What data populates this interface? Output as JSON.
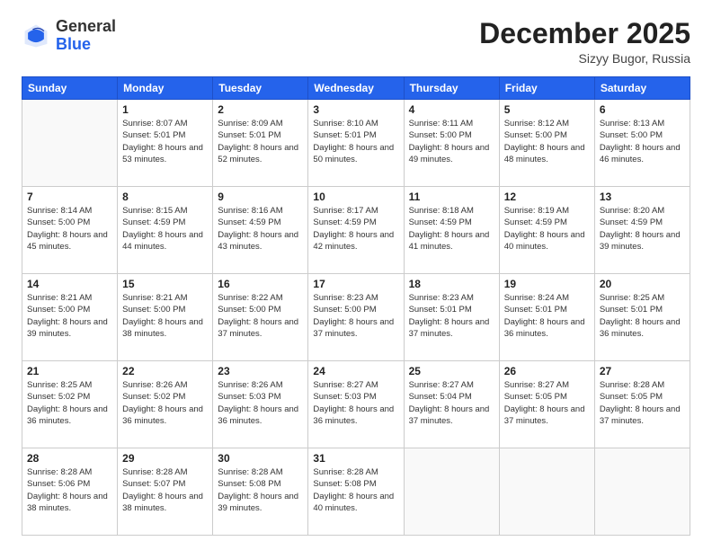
{
  "logo": {
    "general": "General",
    "blue": "Blue"
  },
  "title": "December 2025",
  "location": "Sizyy Bugor, Russia",
  "days_header": [
    "Sunday",
    "Monday",
    "Tuesday",
    "Wednesday",
    "Thursday",
    "Friday",
    "Saturday"
  ],
  "weeks": [
    [
      {
        "day": "",
        "sunrise": "",
        "sunset": "",
        "daylight": ""
      },
      {
        "day": "1",
        "sunrise": "Sunrise: 8:07 AM",
        "sunset": "Sunset: 5:01 PM",
        "daylight": "Daylight: 8 hours and 53 minutes."
      },
      {
        "day": "2",
        "sunrise": "Sunrise: 8:09 AM",
        "sunset": "Sunset: 5:01 PM",
        "daylight": "Daylight: 8 hours and 52 minutes."
      },
      {
        "day": "3",
        "sunrise": "Sunrise: 8:10 AM",
        "sunset": "Sunset: 5:01 PM",
        "daylight": "Daylight: 8 hours and 50 minutes."
      },
      {
        "day": "4",
        "sunrise": "Sunrise: 8:11 AM",
        "sunset": "Sunset: 5:00 PM",
        "daylight": "Daylight: 8 hours and 49 minutes."
      },
      {
        "day": "5",
        "sunrise": "Sunrise: 8:12 AM",
        "sunset": "Sunset: 5:00 PM",
        "daylight": "Daylight: 8 hours and 48 minutes."
      },
      {
        "day": "6",
        "sunrise": "Sunrise: 8:13 AM",
        "sunset": "Sunset: 5:00 PM",
        "daylight": "Daylight: 8 hours and 46 minutes."
      }
    ],
    [
      {
        "day": "7",
        "sunrise": "Sunrise: 8:14 AM",
        "sunset": "Sunset: 5:00 PM",
        "daylight": "Daylight: 8 hours and 45 minutes."
      },
      {
        "day": "8",
        "sunrise": "Sunrise: 8:15 AM",
        "sunset": "Sunset: 4:59 PM",
        "daylight": "Daylight: 8 hours and 44 minutes."
      },
      {
        "day": "9",
        "sunrise": "Sunrise: 8:16 AM",
        "sunset": "Sunset: 4:59 PM",
        "daylight": "Daylight: 8 hours and 43 minutes."
      },
      {
        "day": "10",
        "sunrise": "Sunrise: 8:17 AM",
        "sunset": "Sunset: 4:59 PM",
        "daylight": "Daylight: 8 hours and 42 minutes."
      },
      {
        "day": "11",
        "sunrise": "Sunrise: 8:18 AM",
        "sunset": "Sunset: 4:59 PM",
        "daylight": "Daylight: 8 hours and 41 minutes."
      },
      {
        "day": "12",
        "sunrise": "Sunrise: 8:19 AM",
        "sunset": "Sunset: 4:59 PM",
        "daylight": "Daylight: 8 hours and 40 minutes."
      },
      {
        "day": "13",
        "sunrise": "Sunrise: 8:20 AM",
        "sunset": "Sunset: 4:59 PM",
        "daylight": "Daylight: 8 hours and 39 minutes."
      }
    ],
    [
      {
        "day": "14",
        "sunrise": "Sunrise: 8:21 AM",
        "sunset": "Sunset: 5:00 PM",
        "daylight": "Daylight: 8 hours and 39 minutes."
      },
      {
        "day": "15",
        "sunrise": "Sunrise: 8:21 AM",
        "sunset": "Sunset: 5:00 PM",
        "daylight": "Daylight: 8 hours and 38 minutes."
      },
      {
        "day": "16",
        "sunrise": "Sunrise: 8:22 AM",
        "sunset": "Sunset: 5:00 PM",
        "daylight": "Daylight: 8 hours and 37 minutes."
      },
      {
        "day": "17",
        "sunrise": "Sunrise: 8:23 AM",
        "sunset": "Sunset: 5:00 PM",
        "daylight": "Daylight: 8 hours and 37 minutes."
      },
      {
        "day": "18",
        "sunrise": "Sunrise: 8:23 AM",
        "sunset": "Sunset: 5:01 PM",
        "daylight": "Daylight: 8 hours and 37 minutes."
      },
      {
        "day": "19",
        "sunrise": "Sunrise: 8:24 AM",
        "sunset": "Sunset: 5:01 PM",
        "daylight": "Daylight: 8 hours and 36 minutes."
      },
      {
        "day": "20",
        "sunrise": "Sunrise: 8:25 AM",
        "sunset": "Sunset: 5:01 PM",
        "daylight": "Daylight: 8 hours and 36 minutes."
      }
    ],
    [
      {
        "day": "21",
        "sunrise": "Sunrise: 8:25 AM",
        "sunset": "Sunset: 5:02 PM",
        "daylight": "Daylight: 8 hours and 36 minutes."
      },
      {
        "day": "22",
        "sunrise": "Sunrise: 8:26 AM",
        "sunset": "Sunset: 5:02 PM",
        "daylight": "Daylight: 8 hours and 36 minutes."
      },
      {
        "day": "23",
        "sunrise": "Sunrise: 8:26 AM",
        "sunset": "Sunset: 5:03 PM",
        "daylight": "Daylight: 8 hours and 36 minutes."
      },
      {
        "day": "24",
        "sunrise": "Sunrise: 8:27 AM",
        "sunset": "Sunset: 5:03 PM",
        "daylight": "Daylight: 8 hours and 36 minutes."
      },
      {
        "day": "25",
        "sunrise": "Sunrise: 8:27 AM",
        "sunset": "Sunset: 5:04 PM",
        "daylight": "Daylight: 8 hours and 37 minutes."
      },
      {
        "day": "26",
        "sunrise": "Sunrise: 8:27 AM",
        "sunset": "Sunset: 5:05 PM",
        "daylight": "Daylight: 8 hours and 37 minutes."
      },
      {
        "day": "27",
        "sunrise": "Sunrise: 8:28 AM",
        "sunset": "Sunset: 5:05 PM",
        "daylight": "Daylight: 8 hours and 37 minutes."
      }
    ],
    [
      {
        "day": "28",
        "sunrise": "Sunrise: 8:28 AM",
        "sunset": "Sunset: 5:06 PM",
        "daylight": "Daylight: 8 hours and 38 minutes."
      },
      {
        "day": "29",
        "sunrise": "Sunrise: 8:28 AM",
        "sunset": "Sunset: 5:07 PM",
        "daylight": "Daylight: 8 hours and 38 minutes."
      },
      {
        "day": "30",
        "sunrise": "Sunrise: 8:28 AM",
        "sunset": "Sunset: 5:08 PM",
        "daylight": "Daylight: 8 hours and 39 minutes."
      },
      {
        "day": "31",
        "sunrise": "Sunrise: 8:28 AM",
        "sunset": "Sunset: 5:08 PM",
        "daylight": "Daylight: 8 hours and 40 minutes."
      },
      {
        "day": "",
        "sunrise": "",
        "sunset": "",
        "daylight": ""
      },
      {
        "day": "",
        "sunrise": "",
        "sunset": "",
        "daylight": ""
      },
      {
        "day": "",
        "sunrise": "",
        "sunset": "",
        "daylight": ""
      }
    ]
  ]
}
